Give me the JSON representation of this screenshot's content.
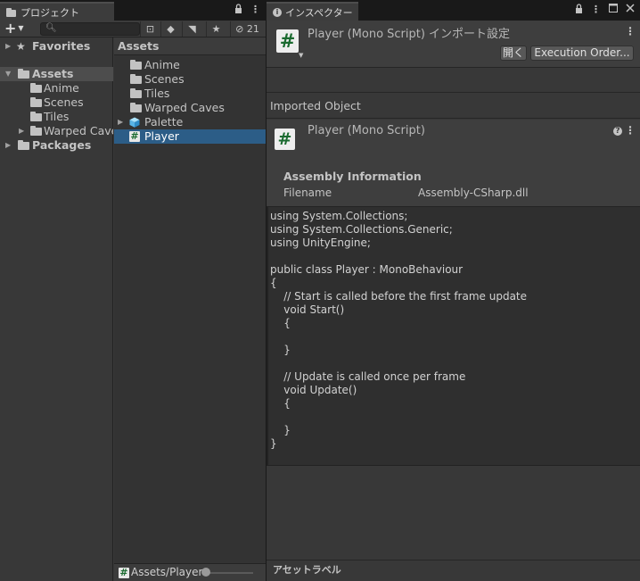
{
  "project": {
    "tab_label": "プロジェクト",
    "badge_count": "21",
    "search_placeholder": "",
    "tree": [
      {
        "label": "Favorites",
        "bold": true
      },
      {
        "label": "Assets",
        "bold": true
      },
      {
        "label": "Anime"
      },
      {
        "label": "Scenes"
      },
      {
        "label": "Tiles"
      },
      {
        "label": "Warped Caves"
      },
      {
        "label": "Packages",
        "bold": true
      }
    ],
    "grid_header": "Assets",
    "items": [
      {
        "label": "Anime"
      },
      {
        "label": "Scenes"
      },
      {
        "label": "Tiles"
      },
      {
        "label": "Warped Caves"
      },
      {
        "label": "Palette"
      },
      {
        "label": "Player"
      }
    ],
    "footer_path": "Assets/Player"
  },
  "inspector": {
    "tab_label": "インスペクター",
    "header_title": "Player (Mono Script) インポート設定",
    "open_button": "開く",
    "execution_order_button": "Execution Order...",
    "imported_object_label": "Imported Object",
    "object_title": "Player (Mono Script)",
    "assembly_title": "Assembly Information",
    "filename_label": "Filename",
    "filename_value": "Assembly-CSharp.dll",
    "code_lines": [
      "using System.Collections;",
      "using System.Collections.Generic;",
      "using UnityEngine;",
      "",
      "public class Player : MonoBehaviour",
      "{",
      "    // Start is called before the first frame update",
      "    void Start()",
      "    {",
      "",
      "    }",
      "",
      "    // Update is called once per frame",
      "    void Update()",
      "    {",
      "",
      "    }",
      "}"
    ],
    "asset_labels": "アセットラベル"
  },
  "icons": {
    "hash_glyph": "#",
    "help_glyph": "?"
  }
}
